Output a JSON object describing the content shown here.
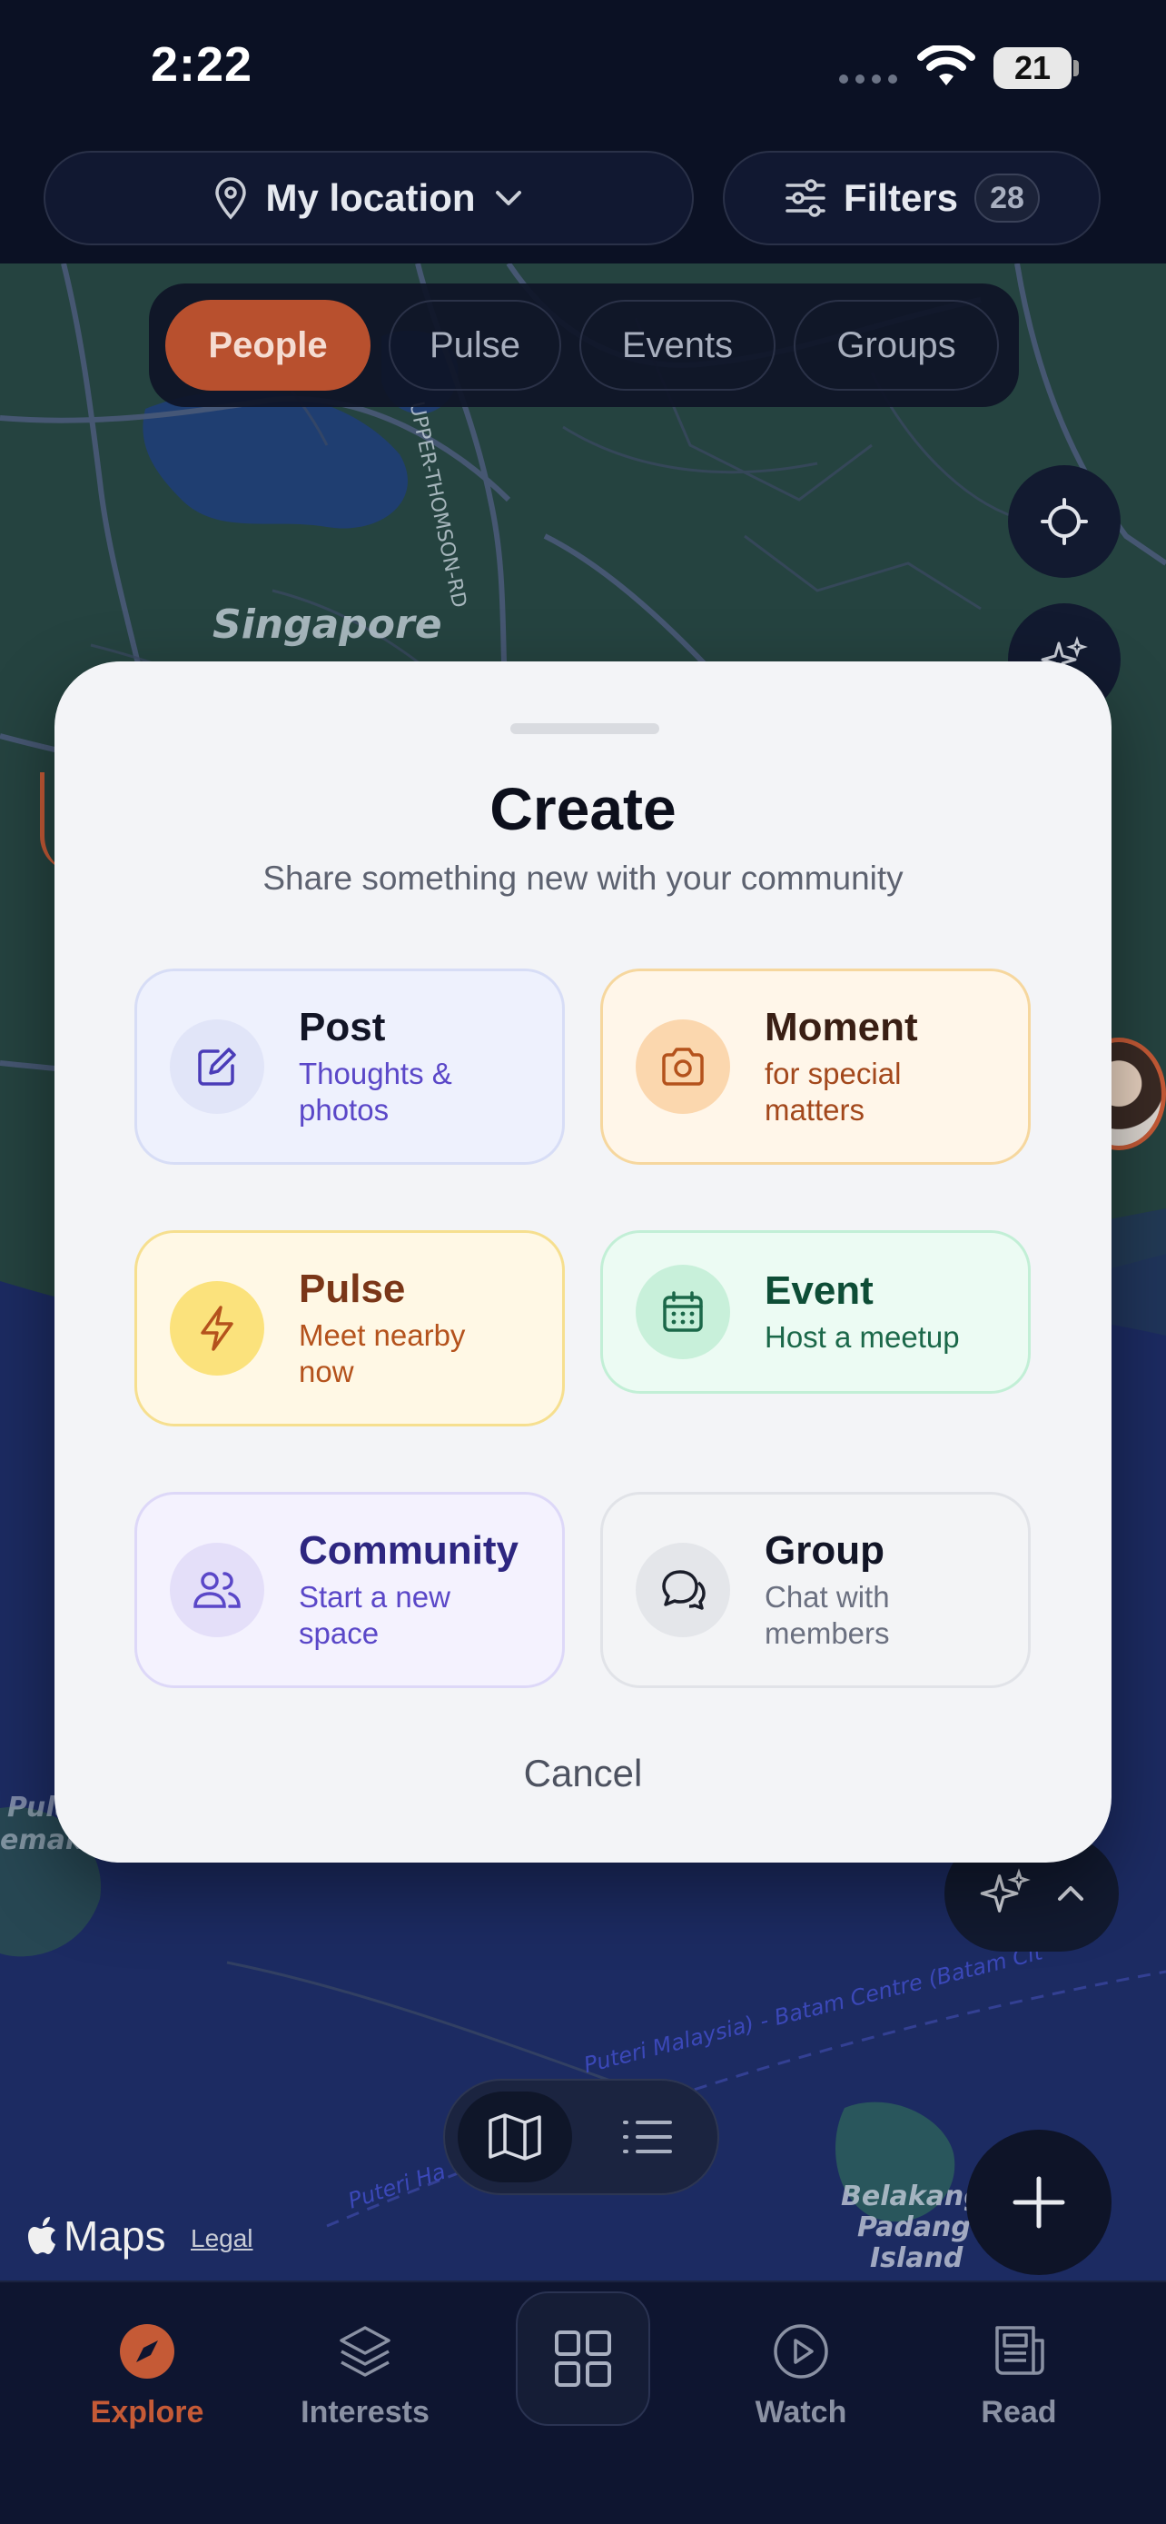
{
  "status": {
    "time": "2:22",
    "battery": "21"
  },
  "topbar": {
    "location_label": "My location",
    "filters_label": "Filters",
    "filters_count": "28"
  },
  "tabs": [
    {
      "label": "People",
      "active": true
    },
    {
      "label": "Pulse",
      "active": false
    },
    {
      "label": "Events",
      "active": false
    },
    {
      "label": "Groups",
      "active": false
    }
  ],
  "map": {
    "labels": [
      "Singapore",
      "UPPER-THOMSON-RD",
      "Pula",
      "emaka",
      "Puteri Malaysia) - Batam Centre (Batam Cit",
      "Puteri Ha",
      "Belakang",
      "Padang",
      "Island"
    ],
    "maps_brand": "Maps",
    "legal": "Legal"
  },
  "sheet": {
    "title": "Create",
    "subtitle": "Share something new with your community",
    "cards": [
      {
        "title": "Post",
        "desc": "Thoughts & photos",
        "icon": "edit-icon",
        "bg": "#eef1fd",
        "border": "#d7ddf6",
        "icon_bg": "#e1e5f8",
        "title_color": "#121526",
        "desc_color": "#5a47c8",
        "icon_color": "#4a3cb8"
      },
      {
        "title": "Moment",
        "desc": "for special matters",
        "icon": "camera-icon",
        "bg": "#fff6e9",
        "border": "#f6d79e",
        "icon_bg": "#fbd7ae",
        "title_color": "#3a1f14",
        "desc_color": "#a3481c",
        "icon_color": "#b4521c"
      },
      {
        "title": "Pulse",
        "desc": "Meet nearby now",
        "icon": "lightning-icon",
        "bg": "#fff8e5",
        "border": "#f6df8f",
        "icon_bg": "#fbe27c",
        "title_color": "#7a3618",
        "desc_color": "#b4521c",
        "icon_color": "#b4521c"
      },
      {
        "title": "Event",
        "desc": "Host a meetup",
        "icon": "calendar-icon",
        "bg": "#ecfbf3",
        "border": "#c2efd6",
        "icon_bg": "#c8f0da",
        "title_color": "#0e4d36",
        "desc_color": "#1b6849",
        "icon_color": "#1b6849"
      },
      {
        "title": "Community",
        "desc": "Start a new space",
        "icon": "people-icon",
        "bg": "#f4f2fe",
        "border": "#ddd8f8",
        "icon_bg": "#e4dff9",
        "title_color": "#2d2680",
        "desc_color": "#5a47c8",
        "icon_color": "#5a47c8"
      },
      {
        "title": "Group",
        "desc": "Chat with members",
        "icon": "chat-bubbles-icon",
        "bg": "#f3f4f6",
        "border": "#e1e3e8",
        "icon_bg": "#e4e6ea",
        "title_color": "#121526",
        "desc_color": "#6b7080",
        "icon_color": "#1b1e2a"
      }
    ],
    "cancel": "Cancel"
  },
  "bottomnav": [
    {
      "label": "Explore",
      "icon": "compass-icon",
      "active": true
    },
    {
      "label": "Interests",
      "icon": "layers-icon",
      "active": false
    },
    {
      "label": "",
      "icon": "grid-icon",
      "active": false
    },
    {
      "label": "Watch",
      "icon": "play-icon",
      "active": false
    },
    {
      "label": "Read",
      "icon": "newspaper-icon",
      "active": false
    }
  ],
  "colors": {
    "accent": "#b8502e",
    "background": "#0b1124",
    "sheet": "#f3f4f7"
  }
}
